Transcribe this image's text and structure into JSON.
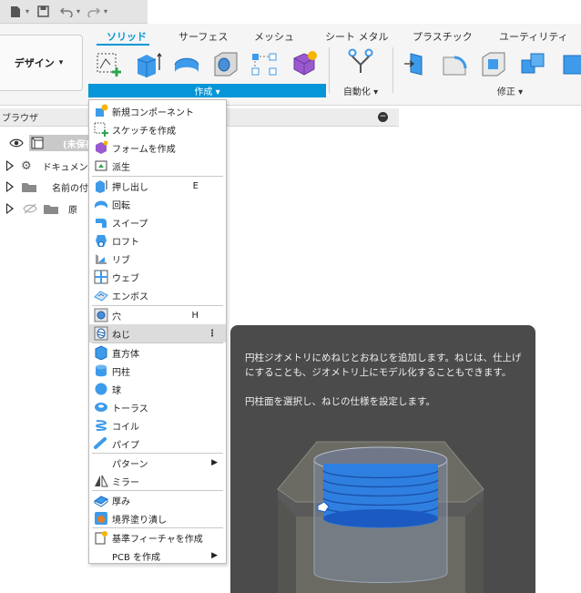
{
  "quick_access": {
    "items": [
      "new-file",
      "save",
      "undo",
      "redo"
    ]
  },
  "ribbon": {
    "design_label": "デザイン",
    "tabs": [
      "ソリッド",
      "サーフェス",
      "メッシュ",
      "シート メタル",
      "プラスチック",
      "ユーティリティ"
    ],
    "active_tab": "ソリッド",
    "groups": {
      "create": "作成 ▾",
      "automate": "自動化 ▾",
      "modify": "修正 ▾"
    }
  },
  "browser": {
    "title": "ブラウザ",
    "collapse_glyph": "−",
    "root_label": "(未保存",
    "rows": [
      "ドキュメント",
      "名前の付",
      "原"
    ]
  },
  "create_menu": {
    "items": [
      {
        "label": "新規コンポーネント",
        "shortcut": ""
      },
      {
        "label": "スケッチを作成",
        "shortcut": ""
      },
      {
        "label": "フォームを作成",
        "shortcut": ""
      },
      {
        "label": "派生",
        "shortcut": ""
      },
      {
        "label": "押し出し",
        "shortcut": "E"
      },
      {
        "label": "回転",
        "shortcut": ""
      },
      {
        "label": "スイープ",
        "shortcut": ""
      },
      {
        "label": "ロフト",
        "shortcut": ""
      },
      {
        "label": "リブ",
        "shortcut": ""
      },
      {
        "label": "ウェブ",
        "shortcut": ""
      },
      {
        "label": "エンボス",
        "shortcut": ""
      },
      {
        "label": "穴",
        "shortcut": "H"
      },
      {
        "label": "ねじ",
        "shortcut": ""
      },
      {
        "label": "直方体",
        "shortcut": ""
      },
      {
        "label": "円柱",
        "shortcut": ""
      },
      {
        "label": "球",
        "shortcut": ""
      },
      {
        "label": "トーラス",
        "shortcut": ""
      },
      {
        "label": "コイル",
        "shortcut": ""
      },
      {
        "label": "パイプ",
        "shortcut": ""
      },
      {
        "label": "パターン",
        "shortcut": ""
      },
      {
        "label": "ミラー",
        "shortcut": ""
      },
      {
        "label": "厚み",
        "shortcut": ""
      },
      {
        "label": "境界塗り潰し",
        "shortcut": ""
      },
      {
        "label": "基準フィーチャを作成",
        "shortcut": ""
      },
      {
        "label": "PCB を作成",
        "shortcut": ""
      }
    ],
    "highlighted": "ねじ",
    "more_glyph": "⋮",
    "submenu_glyph": "▶"
  },
  "tooltip": {
    "text1": "円柱ジオメトリにめねじとおねじを追加します。ねじは、仕上げにすることも、ジオメトリ上にモデル化することもできます。",
    "text2": "円柱面を選択し、ねじの仕様を設定します。"
  },
  "colors": {
    "accent": "#0696d7",
    "tooltip_bg": "#4b4b4b",
    "thread_blue": "#2f7fe0"
  }
}
